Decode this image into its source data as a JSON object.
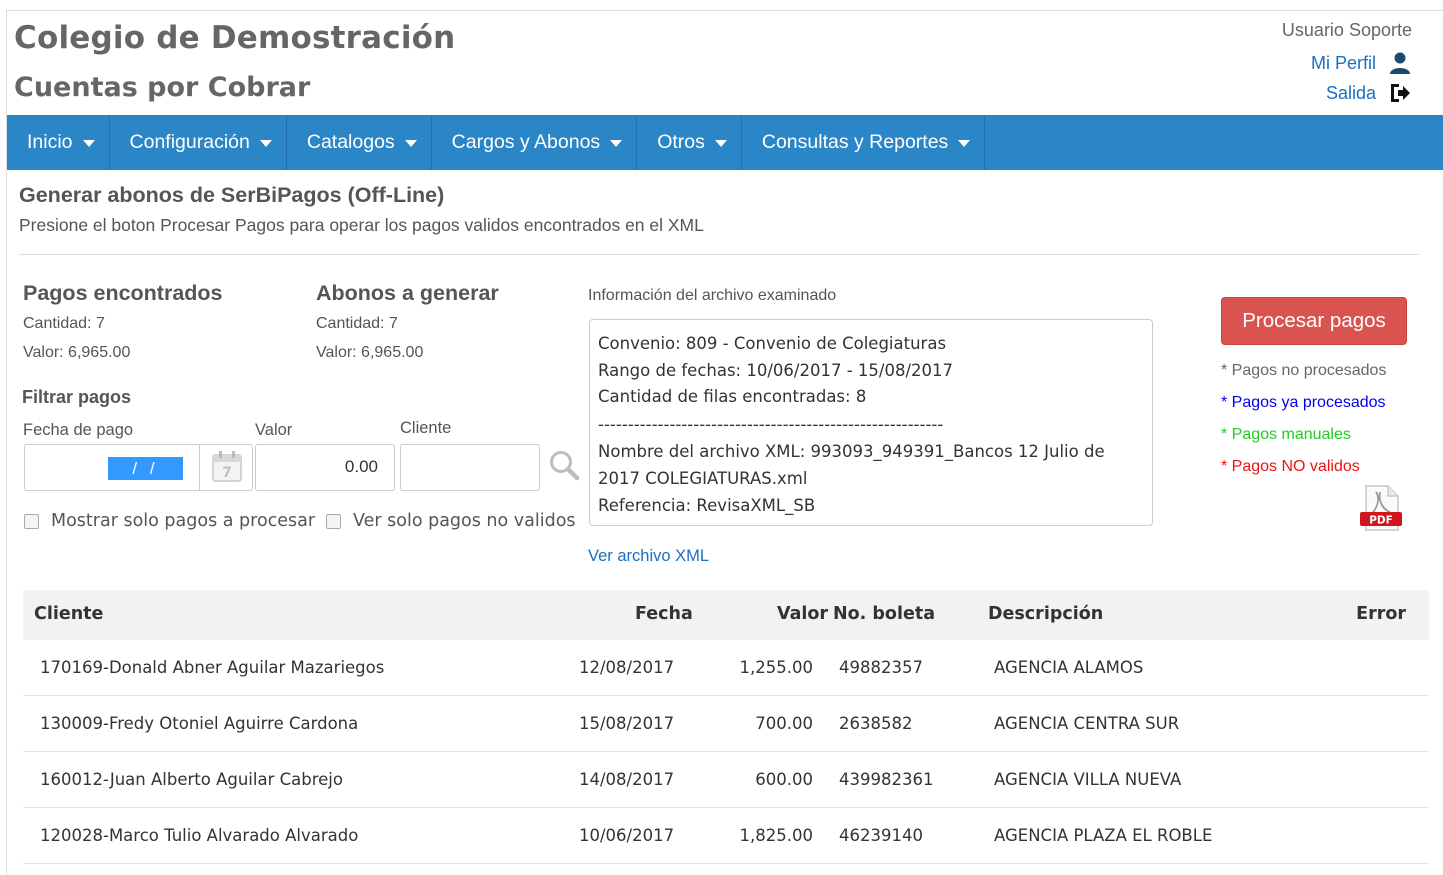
{
  "header": {
    "school": "Colegio de Demostración",
    "module": "Cuentas por Cobrar",
    "user_name": "Usuario Soporte",
    "profile_link": "Mi Perfil",
    "logout_link": "Salida"
  },
  "nav": {
    "items": [
      {
        "label": "Inicio"
      },
      {
        "label": "Configuración"
      },
      {
        "label": "Catalogos"
      },
      {
        "label": "Cargos y Abonos"
      },
      {
        "label": "Otros"
      },
      {
        "label": "Consultas y Reportes"
      }
    ]
  },
  "page": {
    "title": "Generar abonos de SerBiPagos (Off-Line)",
    "description": "Presione el boton Procesar Pagos para operar los pagos validos encontrados en el XML"
  },
  "found": {
    "title": "Pagos encontrados",
    "count": "Cantidad: 7",
    "value": "Valor: 6,965.00"
  },
  "to_generate": {
    "title": "Abonos a generar",
    "count": "Cantidad: 7",
    "value": "Valor: 6,965.00"
  },
  "filter": {
    "title": "Filtrar pagos",
    "date_label": "Fecha de pago",
    "date_value": "/ /",
    "value_label": "Valor",
    "value_value": "0.00",
    "client_label": "Cliente",
    "client_value": "",
    "only_process": "Mostrar solo pagos a procesar",
    "only_invalid": "Ver solo pagos no validos"
  },
  "file_info": {
    "label": "Información del archivo examinado",
    "convenio": "Convenio: 809 - Convenio de Colegiaturas",
    "rango": "Rango de fechas: 10/06/2017 - 15/08/2017",
    "filas": "Cantidad de filas encontradas: 8",
    "separator": "----------------------------------------------------------",
    "nombre": "Nombre del archivo XML: 993093_949391_Bancos 12 Julio de 2017 COLEGIATURAS.xml",
    "referencia": "Referencia: RevisaXML_SB",
    "view_link": "Ver archivo XML"
  },
  "actions": {
    "process_button": "Procesar pagos",
    "pdf_label": "PDF"
  },
  "legend": {
    "not_processed": "* Pagos no procesados",
    "already_processed": "* Pagos ya procesados",
    "manual": "* Pagos manuales",
    "invalid": "* Pagos NO validos",
    "colors": {
      "not_processed": "#666666",
      "already_processed": "#0000ee",
      "manual": "#22cc22",
      "invalid": "#ee1111"
    }
  },
  "table": {
    "columns": {
      "cliente": "Cliente",
      "fecha": "Fecha",
      "valor": "Valor",
      "boleta": "No. boleta",
      "descripcion": "Descripción",
      "error": "Error"
    },
    "rows": [
      {
        "cliente": "170169-Donald Abner Aguilar Mazariegos",
        "fecha": "12/08/2017",
        "valor": "1,255.00",
        "boleta": "49882357",
        "descripcion": "AGENCIA ALAMOS",
        "error": ""
      },
      {
        "cliente": "130009-Fredy Otoniel Aguirre Cardona",
        "fecha": "15/08/2017",
        "valor": "700.00",
        "boleta": "2638582",
        "descripcion": "AGENCIA CENTRA SUR",
        "error": ""
      },
      {
        "cliente": "160012-Juan Alberto Aguilar Cabrejo",
        "fecha": "14/08/2017",
        "valor": "600.00",
        "boleta": "439982361",
        "descripcion": "AGENCIA VILLA NUEVA",
        "error": ""
      },
      {
        "cliente": "120028-Marco Tulio Alvarado Alvarado",
        "fecha": "10/06/2017",
        "valor": "1,825.00",
        "boleta": "46239140",
        "descripcion": "AGENCIA PLAZA EL ROBLE",
        "error": ""
      }
    ]
  }
}
